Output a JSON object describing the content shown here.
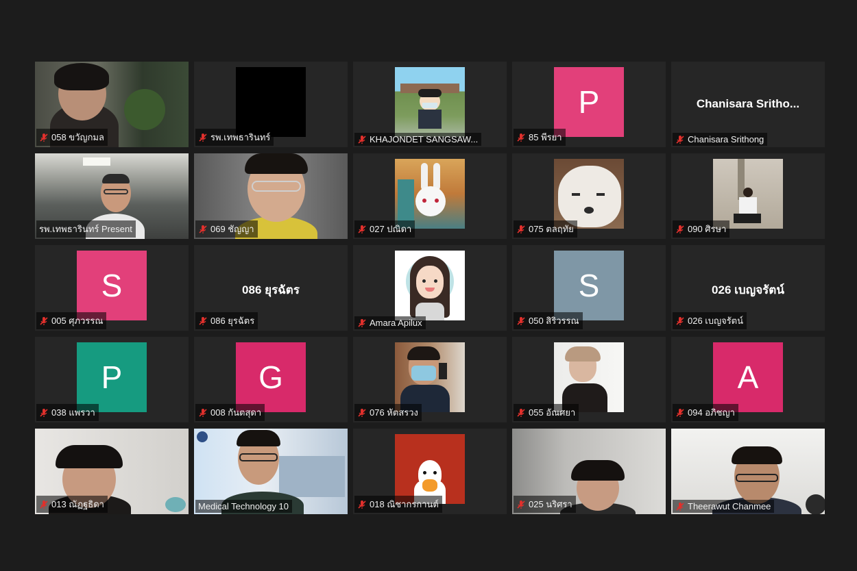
{
  "colors": {
    "background": "#1c1c1c",
    "tile": "#262626",
    "active_border": "#b7e36d",
    "muted_mic": "#e0302c"
  },
  "tiles": [
    {
      "name": "058 ขวัญกมล",
      "muted": true,
      "kind": "video"
    },
    {
      "name": "รพ.เทพธารินทร์",
      "muted": true,
      "kind": "video-black"
    },
    {
      "name": "KHAJONDET SANGSAW...",
      "muted": true,
      "kind": "image-cartoon"
    },
    {
      "name": "85 พีรยา",
      "muted": true,
      "kind": "letter",
      "letter": "P",
      "color": "#e2407a"
    },
    {
      "name": "Chanisara Srithong",
      "muted": true,
      "kind": "text",
      "display": "Chanisara  Sritho..."
    },
    {
      "name": "รพ.เทพธารินทร์ Present",
      "muted": false,
      "kind": "video",
      "active": true
    },
    {
      "name": "069 ชัญญา",
      "muted": true,
      "kind": "video"
    },
    {
      "name": "027 ปณิดา",
      "muted": true,
      "kind": "image-rabbit"
    },
    {
      "name": "075 ตลฤทัย",
      "muted": true,
      "kind": "image-dog"
    },
    {
      "name": "090 ศิรษา",
      "muted": true,
      "kind": "image-photo"
    },
    {
      "name": "005 ศุภวรรณ",
      "muted": true,
      "kind": "letter",
      "letter": "S",
      "color": "#e2407a"
    },
    {
      "name": "086 ยุรฉัตร",
      "muted": true,
      "kind": "text",
      "display": "086 ยุรฉัตร"
    },
    {
      "name": "Amara Apilux",
      "muted": true,
      "kind": "image-girl"
    },
    {
      "name": "050 สิริวรรณ",
      "muted": true,
      "kind": "letter",
      "letter": "S",
      "color": "#7f97a6"
    },
    {
      "name": "026 เบญจรัตน์",
      "muted": true,
      "kind": "text",
      "display": "026 เบญจรัตน์"
    },
    {
      "name": "038 แพรวา",
      "muted": true,
      "kind": "letter",
      "letter": "P",
      "color": "#169b80"
    },
    {
      "name": "008 กันตสุดา",
      "muted": true,
      "kind": "letter",
      "letter": "G",
      "color": "#d82a6a"
    },
    {
      "name": "076 หัตสรวง",
      "muted": true,
      "kind": "image-selfie"
    },
    {
      "name": "055 อัณศยา",
      "muted": true,
      "kind": "image-photo2"
    },
    {
      "name": "094 อภิชญา",
      "muted": true,
      "kind": "letter",
      "letter": "A",
      "color": "#d82a6a"
    },
    {
      "name": "013 ณัฏฐธิดา",
      "muted": true,
      "kind": "video"
    },
    {
      "name": "Medical Technology 10",
      "muted": false,
      "kind": "video"
    },
    {
      "name": "018 ณิชากรกานต์",
      "muted": true,
      "kind": "image-duck"
    },
    {
      "name": "025 นริศรา",
      "muted": true,
      "kind": "video"
    },
    {
      "name": "Theerawut Chanmee",
      "muted": true,
      "kind": "video"
    }
  ]
}
